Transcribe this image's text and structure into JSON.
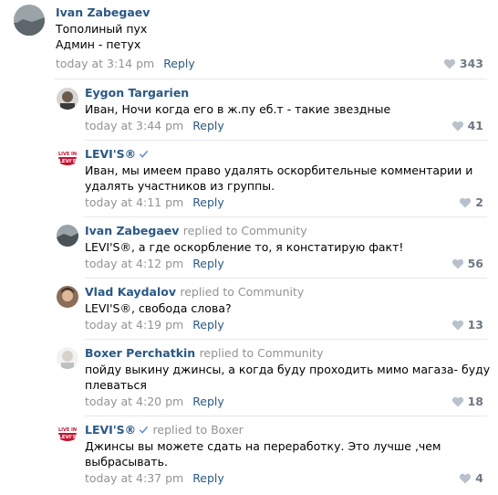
{
  "comments": [
    {
      "author": "Ivan Zabegaev",
      "replied": "",
      "lines": [
        "Тополиный пух",
        "Админ - петух"
      ],
      "time": "today at 3:14 pm",
      "reply_label": "Reply",
      "likes": "343"
    },
    {
      "author": "Eygon Targarien",
      "replied": "",
      "lines": [
        "Иван, Ночи когда его в ж.пу еб.т - такие звездные"
      ],
      "time": "today at 3:44 pm",
      "reply_label": "Reply",
      "likes": "41"
    },
    {
      "author": "LEVI'S®",
      "replied": "",
      "lines": [
        "Иван, мы имеем право удалять оскорбительные комментарии и",
        "удалять участников из группы."
      ],
      "time": "today at 4:11 pm",
      "reply_label": "Reply",
      "likes": "2"
    },
    {
      "author": "Ivan Zabegaev",
      "replied_prefix": "replied to",
      "replied_target": "Community",
      "lines": [
        "LEVI'S®, а где оскорбление то, я констатирую факт!"
      ],
      "time": "today at 4:12 pm",
      "reply_label": "Reply",
      "likes": "56"
    },
    {
      "author": "Vlad Kaydalov",
      "replied_prefix": "replied to",
      "replied_target": "Community",
      "lines": [
        "LEVI'S®, свобода слова?"
      ],
      "time": "today at 4:19 pm",
      "reply_label": "Reply",
      "likes": "13"
    },
    {
      "author": "Boxer Perchatkin",
      "replied_prefix": "replied to",
      "replied_target": "Community",
      "lines": [
        "пойду выкину джинсы, а когда буду проходить мимо магаза- буду",
        "плеваться"
      ],
      "time": "today at 4:20 pm",
      "reply_label": "Reply",
      "likes": "18"
    },
    {
      "author": "LEVI'S®",
      "replied_prefix": "replied to",
      "replied_target": "Boxer",
      "lines": [
        "Джинсы вы можете сдать на переработку. Это лучше ,чем",
        "выбрасывать."
      ],
      "time": "today at 4:37 pm",
      "reply_label": "Reply",
      "likes": "4"
    }
  ],
  "colors": {
    "link": "#2a5885",
    "muted": "#939393",
    "levis_red": "#c41230"
  }
}
